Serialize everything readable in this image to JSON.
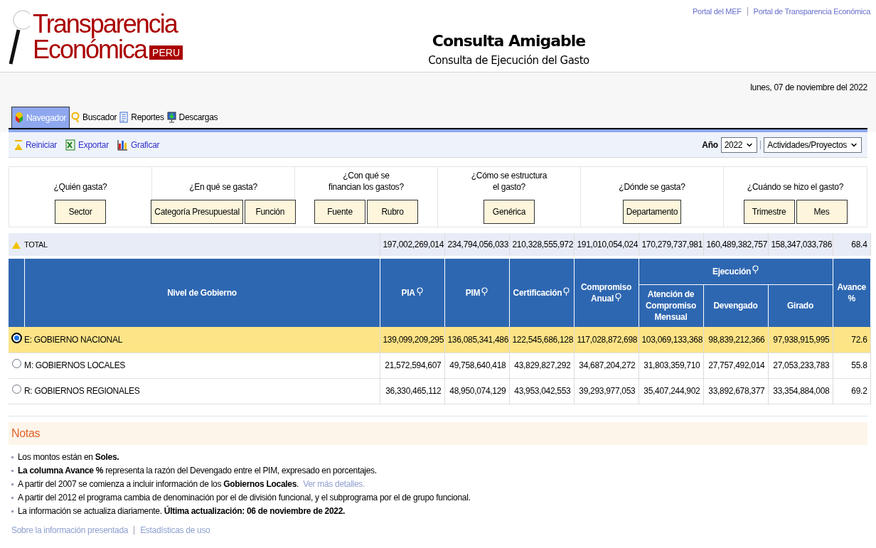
{
  "header": {
    "logo": {
      "line_1": "Transparencia",
      "line_2": "Económica",
      "badge": "PERU"
    },
    "title": "Consulta Amigable",
    "subtitle": "Consulta de Ejecución del Gasto",
    "links": [
      "Portal del MEF",
      "Portal de Transparencia Económica"
    ]
  },
  "date": "lunes, 07 de noviembre del 2022",
  "tabs": [
    {
      "label": "Navegador",
      "selected": true,
      "kind": "nav"
    },
    {
      "label": "Buscador",
      "selected": false,
      "kind": "search"
    },
    {
      "label": "Reportes",
      "selected": false,
      "kind": "report"
    },
    {
      "label": "Descargas",
      "selected": false,
      "kind": "download"
    }
  ],
  "toolbar": {
    "actions": [
      {
        "label": "Reiniciar",
        "kind": "reset"
      },
      {
        "label": "Exportar",
        "kind": "excel"
      },
      {
        "label": "Graficar",
        "kind": "chart"
      }
    ],
    "year_label": "Año",
    "year": "2022",
    "mode": "Actividades/Proyectos"
  },
  "categories": [
    {
      "question": "¿Quién gasta?",
      "buttons": [
        "Sector"
      ]
    },
    {
      "question": "¿En qué se gasta?",
      "buttons": [
        "Categoría Presupuestal",
        "Función"
      ]
    },
    {
      "question": "¿Con qué se\nfinancian los gastos?",
      "buttons": [
        "Fuente",
        "Rubro"
      ]
    },
    {
      "question": "¿Cómo se estructura\nel gasto?",
      "buttons": [
        "Genérica"
      ]
    },
    {
      "question": "¿Dónde se gasta?",
      "buttons": [
        "Departamento"
      ]
    },
    {
      "question": "¿Cuándo se hizo el gasto?",
      "buttons": [
        "Trimestre",
        "Mes"
      ]
    }
  ],
  "total": {
    "label": "TOTAL",
    "values": [
      "197,002,269,014",
      "234,794,056,033",
      "210,328,555,972",
      "191,010,054,024",
      "170,279,737,981",
      "160,489,382,757",
      "158,347,033,786",
      "68.4"
    ]
  },
  "table": {
    "name_column": "Nivel de Gobierno",
    "columns": [
      {
        "label": "PIA",
        "pin": true
      },
      {
        "label": "PIM",
        "pin": true
      },
      {
        "label": "Certificación",
        "pin": true
      },
      {
        "label": "Compromiso Anual",
        "pin": true
      }
    ],
    "group": {
      "label": "Ejecución",
      "pin": true,
      "columns": [
        {
          "label": "Atención de Compromiso Mensual",
          "pin": false
        },
        {
          "label": "Devengado",
          "pin": false
        },
        {
          "label": "Girado",
          "pin": false
        }
      ]
    },
    "last_column": "Avance %",
    "rows": [
      {
        "label": "E: GOBIERNO NACIONAL",
        "selected": true,
        "values": [
          "139,099,209,295",
          "136,085,341,486",
          "122,545,686,128",
          "117,028,872,698",
          "103,069,133,368",
          "98,839,212,366",
          "97,938,915,995",
          "72.6"
        ]
      },
      {
        "label": "M: GOBIERNOS LOCALES",
        "selected": false,
        "values": [
          "21,572,594,607",
          "49,758,640,418",
          "43,829,827,292",
          "34,687,204,272",
          "31,803,359,710",
          "27,757,492,014",
          "27,053,233,783",
          "55.8"
        ]
      },
      {
        "label": "R: GOBIERNOS REGIONALES",
        "selected": false,
        "values": [
          "36,330,465,112",
          "48,950,074,129",
          "43,953,042,553",
          "39,293,977,053",
          "35,407,244,902",
          "33,892,678,377",
          "33,354,884,008",
          "69.2"
        ]
      }
    ]
  },
  "notes": {
    "title": "Notas",
    "items": [
      {
        "text": "Los montos están en **Soles.**"
      },
      {
        "text": "**La columna Avance %** representa la razón del Devengado entre el PIM, expresado en porcentajes."
      },
      {
        "text": "A partir del 2007 se comienza a incluir información de los **Gobiernos Locales**.",
        "link": "Ver más detalles."
      },
      {
        "text": "A partir del 2012 el programa cambia de denominación por el de división funcional, y el subprograma por el de grupo funcional."
      },
      {
        "text": "La información se actualiza diariamente. **Última actualización: 06 de noviembre de 2022.**"
      }
    ],
    "footer_links": [
      "Sobre la información presentada",
      "Estadísticas de uso"
    ]
  }
}
